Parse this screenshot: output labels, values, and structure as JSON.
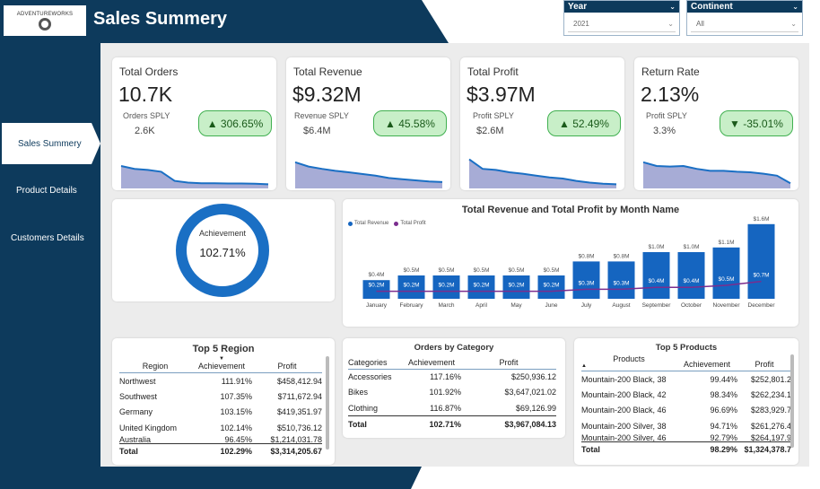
{
  "header": {
    "title": "Sales Summery",
    "logo_text": "ADVENTUREWORKS"
  },
  "filters": {
    "year": {
      "label": "Year",
      "value": "2021"
    },
    "continent": {
      "label": "Continent",
      "value": "All"
    }
  },
  "nav": [
    {
      "label": "Sales Summery",
      "active": true
    },
    {
      "label": "Product Details",
      "active": false
    },
    {
      "label": "Customers Details",
      "active": false
    }
  ],
  "kpis": [
    {
      "title": "Total Orders",
      "value": "10.7K",
      "sply_label": "Orders SPLY",
      "sply_value": "2.6K",
      "change": "▲ 306.65%",
      "trend": [
        0.72,
        0.62,
        0.58,
        0.52,
        0.2,
        0.14,
        0.12,
        0.12,
        0.11,
        0.11,
        0.1,
        0.08
      ]
    },
    {
      "title": "Total Revenue",
      "value": "$9.32M",
      "sply_label": "Revenue SPLY",
      "sply_value": "$6.4M",
      "change": "▲ 45.58%",
      "trend": [
        0.85,
        0.7,
        0.62,
        0.55,
        0.5,
        0.44,
        0.38,
        0.3,
        0.26,
        0.22,
        0.18,
        0.16
      ]
    },
    {
      "title": "Total Profit",
      "value": "$3.97M",
      "sply_label": "Profit SPLY",
      "sply_value": "$2.6M",
      "change": "▲ 52.49%",
      "trend": [
        0.95,
        0.62,
        0.58,
        0.5,
        0.45,
        0.38,
        0.32,
        0.28,
        0.2,
        0.14,
        0.1,
        0.08
      ]
    },
    {
      "title": "Return Rate",
      "value": "2.13%",
      "sply_label": "Profit SPLY",
      "sply_value": "3.3%",
      "change": "▼ -35.01%",
      "trend": [
        0.85,
        0.72,
        0.7,
        0.72,
        0.62,
        0.55,
        0.55,
        0.52,
        0.5,
        0.45,
        0.38,
        0.12
      ]
    }
  ],
  "achievement": {
    "label": "Achievement",
    "value": "102.71%",
    "percent": 102.71
  },
  "chart_data": {
    "type": "bar",
    "title": "Total Revenue and Total Profit by Month Name",
    "categories": [
      "January",
      "February",
      "March",
      "April",
      "May",
      "June",
      "July",
      "August",
      "September",
      "October",
      "November",
      "December"
    ],
    "series": [
      {
        "name": "Total Revenue",
        "type": "bar",
        "color": "#1565c0",
        "values": [
          0.4,
          0.5,
          0.5,
          0.5,
          0.5,
          0.5,
          0.8,
          0.8,
          1.0,
          1.0,
          1.1,
          1.6
        ],
        "labels": [
          "$0.4M",
          "$0.5M",
          "$0.5M",
          "$0.5M",
          "$0.5M",
          "$0.5M",
          "$0.8M",
          "$0.8M",
          "$1.0M",
          "$1.0M",
          "$1.1M",
          "$1.6M"
        ]
      },
      {
        "name": "Total Profit",
        "type": "line",
        "color": "#7b2d8e",
        "values": [
          0.2,
          0.2,
          0.2,
          0.2,
          0.2,
          0.2,
          0.3,
          0.3,
          0.4,
          0.4,
          0.5,
          0.7
        ],
        "labels": [
          "$0.2M",
          "$0.2M",
          "$0.2M",
          "$0.2M",
          "$0.2M",
          "$0.2M",
          "$0.3M",
          "$0.3M",
          "$0.4M",
          "$0.4M",
          "$0.5M",
          "$0.7M"
        ]
      }
    ],
    "legend": "top-left",
    "grid": false
  },
  "region_table": {
    "title": "Top 5 Region",
    "headers": [
      "Region",
      "Achievement",
      "Profit"
    ],
    "rows": [
      [
        "Northwest",
        "111.91%",
        "$458,412.94"
      ],
      [
        "Southwest",
        "107.35%",
        "$711,672.94"
      ],
      [
        "Germany",
        "103.15%",
        "$419,351.97"
      ],
      [
        "United Kingdom",
        "102.14%",
        "$510,736.12"
      ],
      [
        "Australia",
        "96.45%",
        "$1,214,031.78"
      ]
    ],
    "total": [
      "Total",
      "102.29%",
      "$3,314,205.67"
    ]
  },
  "category_table": {
    "title": "Orders by Category",
    "headers": [
      "Categories",
      "Achievement",
      "Profit"
    ],
    "rows": [
      [
        "Accessories",
        "117.16%",
        "$250,936.12"
      ],
      [
        "Bikes",
        "101.92%",
        "$3,647,021.02"
      ],
      [
        "Clothing",
        "116.87%",
        "$69,126.99"
      ]
    ],
    "total": [
      "Total",
      "102.71%",
      "$3,967,084.13"
    ]
  },
  "products_table": {
    "title": "Top 5 Products",
    "headers": [
      "Products",
      "Achievement",
      "Profit"
    ],
    "rows": [
      [
        "Mountain-200 Black, 38",
        "99.44%",
        "$252,801.2"
      ],
      [
        "Mountain-200 Black, 42",
        "98.34%",
        "$262,234.1"
      ],
      [
        "Mountain-200 Black, 46",
        "96.69%",
        "$283,929.7"
      ],
      [
        "Mountain-200 Silver, 38",
        "94.71%",
        "$261,276.4"
      ],
      [
        "Mountain-200 Silver, 46",
        "92.79%",
        "$264,197.9"
      ]
    ],
    "total": [
      "Total",
      "98.29%",
      "$1,324,378.7"
    ]
  }
}
